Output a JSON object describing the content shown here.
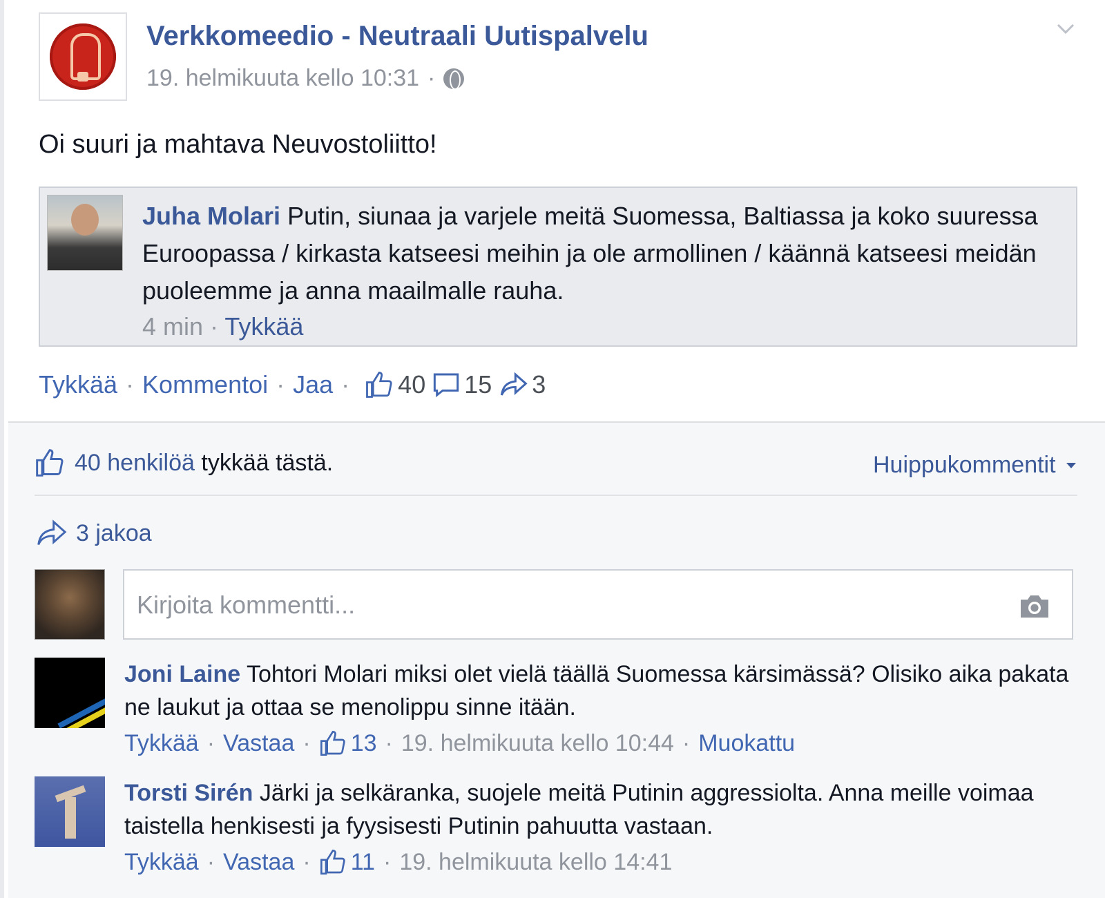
{
  "post": {
    "page_name": "Verkkomeedio - Neutraali Uutispalvelu",
    "timestamp": "19. helmikuuta kello 10:31",
    "meta_sep": "·",
    "audience_icon": "globe-icon",
    "menu_icon": "chevron-down-icon",
    "text": "Oi suuri ja mahtava Neuvostoliitto!",
    "quoted_comment": {
      "author": "Juha Molari",
      "text": "Putin, siunaa ja varjele meitä Suomessa, Baltiassa ja koko suuressa Euroopassa / kirkasta katseesi meihin ja ole armollinen / käännä katseesi meidän puoleemme ja anna maailmalle rauha.",
      "time": "4 min",
      "sep": "·",
      "like": "Tykkää"
    },
    "actions": {
      "like": "Tykkää",
      "comment": "Kommentoi",
      "share": "Jaa",
      "sep": "·",
      "like_count": "40",
      "comment_count": "15",
      "share_count": "3"
    }
  },
  "ufi": {
    "likes_count_text": "40 henkilöä",
    "likes_suffix": " tykkää tästä.",
    "sort_label": "Huippukommentit",
    "shares_text": "3 jakoa",
    "comment_placeholder": "Kirjoita kommentti...",
    "comments": [
      {
        "author": "Joni Laine",
        "text": "Tohtori Molari miksi olet vielä täällä Suomessa kärsimässä? Olisiko aika pakata ne laukut ja ottaa se menolippu sinne itään.",
        "like": "Tykkää",
        "reply": "Vastaa",
        "likes": "13",
        "time": "19. helmikuuta kello 10:44",
        "edited": "Muokattu",
        "sep": "·"
      },
      {
        "author": "Torsti Sirén",
        "text": "Järki ja selkäranka, suojele meitä Putinin aggressiolta. Anna meille voimaa taistella henkisesti ja fyysisesti Putinin pahuutta vastaan.",
        "like": "Tykkää",
        "reply": "Vastaa",
        "likes": "11",
        "time": "19. helmikuuta kello 14:41",
        "sep": "·"
      }
    ]
  },
  "colors": {
    "link": "#3b5998",
    "action": "#4267b2",
    "muted": "#90949c"
  }
}
